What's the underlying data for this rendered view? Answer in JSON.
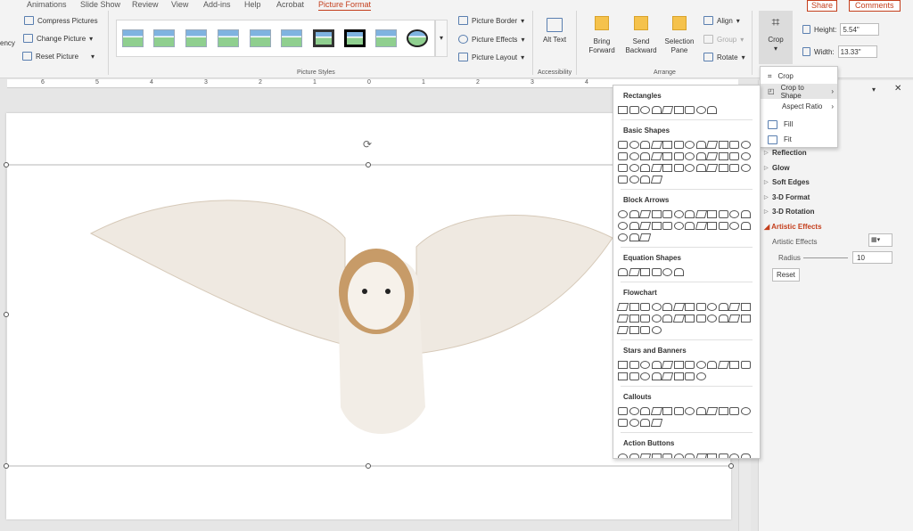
{
  "tabs": [
    "Animations",
    "Slide Show",
    "Review",
    "View",
    "Add-ins",
    "Help",
    "Acrobat",
    "Picture Format"
  ],
  "header_buttons": {
    "share": "Share",
    "comments": "Comments"
  },
  "ribbon": {
    "adjust": {
      "transparency_partial": "ency",
      "compress": "Compress Pictures",
      "change": "Change Picture",
      "reset": "Reset Picture"
    },
    "picture_styles_label": "Picture Styles",
    "picture_border": "Picture Border",
    "picture_effects": "Picture Effects",
    "picture_layout": "Picture Layout",
    "alt_text": "Alt Text",
    "accessibility_label": "Accessibility",
    "bring_forward": "Bring Forward",
    "send_backward": "Send Backward",
    "selection_pane": "Selection Pane",
    "align": "Align",
    "group": "Group",
    "rotate": "Rotate",
    "arrange_label": "Arrange",
    "crop": "Crop",
    "height_label": "Height:",
    "height_value": "5.54\"",
    "width_label": "Width:",
    "width_value": "13.33\""
  },
  "ruler_labels": [
    "6",
    "5",
    "4",
    "3",
    "2",
    "1",
    "0",
    "1",
    "2",
    "3",
    "4"
  ],
  "crop_menu": [
    "Crop",
    "Crop to Shape",
    "Aspect Ratio",
    "Fill",
    "Fit"
  ],
  "shapes_menu": [
    {
      "title": "Rectangles",
      "rows": [
        9
      ]
    },
    {
      "title": "Basic Shapes",
      "rows": [
        12,
        12,
        12,
        4
      ]
    },
    {
      "title": "Block Arrows",
      "rows": [
        12,
        12,
        3
      ]
    },
    {
      "title": "Equation Shapes",
      "rows": [
        6
      ]
    },
    {
      "title": "Flowchart",
      "rows": [
        12,
        12,
        4
      ]
    },
    {
      "title": "Stars and Banners",
      "rows": [
        12,
        8
      ]
    },
    {
      "title": "Callouts",
      "rows": [
        12,
        4
      ]
    },
    {
      "title": "Action Buttons",
      "rows": [
        12
      ]
    }
  ],
  "format_pane": {
    "sections": [
      "Reflection",
      "Glow",
      "Soft Edges",
      "3-D Format",
      "3-D Rotation"
    ],
    "artistic_header": "Artistic Effects",
    "artistic_label": "Artistic Effects",
    "radius_label": "Radius",
    "radius_value": "10",
    "reset": "Reset"
  },
  "colors": {
    "accent": "#c43e1c",
    "ribbon": "#f3f3f3",
    "highlight": "#e5e5e5"
  }
}
